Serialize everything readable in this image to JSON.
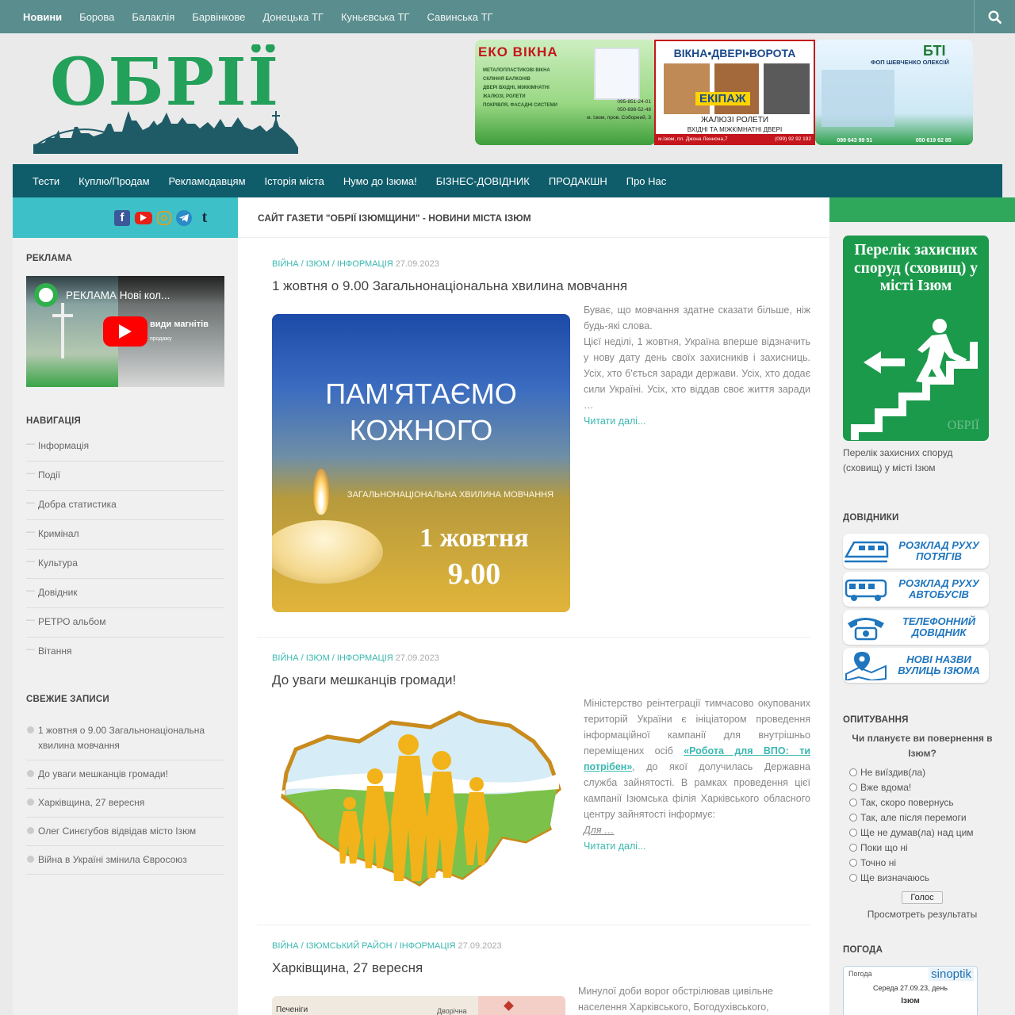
{
  "top_nav": {
    "items": [
      "Новини",
      "Борова",
      "Балаклія",
      "Барвінкове",
      "Донецька ТГ",
      "Куньєвська ТГ",
      "Савинська ТГ"
    ],
    "search_icon": "search-icon"
  },
  "header": {
    "logo_text": "ОБРІЇ",
    "banners": {
      "eko": {
        "title": "ЕКО ВІКНА",
        "line1": "МЕТАЛОПЛАСТИКОВІ ВІКНА",
        "line2": "СКЛІННЯ БАЛКОНІВ",
        "line3": "ДВЕРІ ВХІДНІ, МІЖКІМНАТНІ",
        "line4": "ЖАЛЮЗІ, РОЛЕТИ",
        "line5": "ПОКРІВЛЯ, ФАСАДНІ СИСТЕМИ",
        "phone1": "095-851-24-01",
        "phone2": "050-698-52-48",
        "address": "м. Ізюм, пров. Соборний, 3"
      },
      "ekipazh": {
        "title": "ВІКНА•ДВЕРІ•ВОРОТА",
        "brand": "ЕКІПАЖ",
        "sub": "ЖАЛЮЗІ РОЛЕТИ",
        "sub2": "ВХІДНІ ТА МІЖКІМНАТНІ ДВЕРІ",
        "address": "м.Ізюм, пл. Джона Леннона,7",
        "phone": "(099) 92 92 192"
      },
      "bti": {
        "title": "БТІ",
        "name": "ФОП ШЕВЧЕНКО ОЛЕКСІЙ",
        "phone1": "099 643 99 51",
        "phone2": "050 619 62 85"
      }
    }
  },
  "main_nav": {
    "items": [
      "Тести",
      "Куплю/Продам",
      "Рекламодавцям",
      "Історія міста",
      "Нумо до Ізюма!",
      "БІЗНЕС-ДОВІДНИК",
      "ПРОДАКШН",
      "Про Нас"
    ]
  },
  "left": {
    "ad_title": "РЕКЛАМА",
    "video_title": "РЕКЛАМА Нові кол...",
    "video_caption": "види магнітів",
    "video_caption2": "продажу",
    "nav_title": "НАВИГАЦІЯ",
    "nav_items": [
      "Інформація",
      "Події",
      "Добра статистика",
      "Кримінал",
      "Культура",
      "Довідник",
      "РЕТРО альбом",
      "Вітання"
    ],
    "recent_title": "СВЕЖИЕ ЗАПИСИ",
    "recent_items": [
      "1 жовтня о 9.00 Загальнонаціональна хвилина мовчання",
      "До уваги мешканців громади!",
      "Харківщина, 27 вересня",
      "Олег Синєгубов відвідав місто Ізюм",
      "Війна в Україні змінила Євросоюз"
    ]
  },
  "center": {
    "page_title": "САЙТ ГАЗЕТИ \"ОБРІЇ ІЗЮМЩИНИ\" - НОВИНИ МІСТА ІЗЮМ",
    "posts": [
      {
        "cats": [
          "ВІЙНА",
          "ІЗЮМ",
          "ІНФОРМАЦІЯ"
        ],
        "date": "27.09.2023",
        "title": "1 жовтня о 9.00 Загальнонаціональна хвилина мовчання",
        "excerpt": "Буває, що мовчання здатне сказати більше, ніж будь-які слова.\nЦієї неділі, 1 жовтня, Україна вперше відзначить у нову дату день своїх захисників і захисниць. Усіх, хто б'ється заради держави. Усіх, хто додає сили Україні. Усіх, хто віддав своє життя заради …",
        "more": "Читати далі...",
        "image_text": {
          "l1": "ПАМ'ЯТАЄМО",
          "l2": "КОЖНОГО",
          "l3": "ЗАГАЛЬНОНАЦІОНАЛЬНА ХВИЛИНА МОВЧАННЯ",
          "l4": "1 жовтня",
          "l5": "9.00"
        }
      },
      {
        "cats": [
          "ВІЙНА",
          "ІЗЮМ",
          "ІНФОРМАЦІЯ"
        ],
        "date": "27.09.2023",
        "title": "До уваги мешканців громади!",
        "excerpt_a": "Міністерство реінтеграції тимчасово окупованих територій України є ініціатором проведення інформаційної кампанії для внутрішньо переміщених осіб ",
        "excerpt_link": "«Робота для ВПО: ти потрібен»",
        "excerpt_b": ", до якої долучилась Державна служба зайнятості. В рамках проведення цієї кампанії Ізюмська філія Харківського обласного центру зайнятості інформує:",
        "excerpt_c": "Для …",
        "more": "Читати далі..."
      },
      {
        "cats": [
          "ВІЙНА",
          "ІЗЮМСЬКИЙ РАЙОН",
          "ІНФОРМАЦІЯ"
        ],
        "date": "27.09.2023",
        "title": "Харківщина, 27 вересня",
        "excerpt": "Минулої доби ворог обстрілював цивільне населення Харківського, Богодухівського,",
        "map_label1": "Печеніги",
        "map_label2": "Дворічна"
      }
    ]
  },
  "right": {
    "shelter_sign": "Перелік захисних споруд (сховищ) у місті Ізюм",
    "shelter_watermark": "ОБРІЇ",
    "shelter_caption": "Перелік захисних споруд (сховищ) у місті Ізюм",
    "dir_title": "ДОВІДНИКИ",
    "dirs": [
      {
        "l1": "РОЗКЛАД РУХУ",
        "l2": "ПОТЯГІВ",
        "icon": "train-icon"
      },
      {
        "l1": "РОЗКЛАД РУХУ",
        "l2": "АВТОБУСІВ",
        "icon": "bus-icon"
      },
      {
        "l1": "ТЕЛЕФОННИЙ",
        "l2": "ДОВІДНИК",
        "icon": "phone-icon"
      },
      {
        "l1": "НОВІ НАЗВИ",
        "l2": "ВУЛИЦЬ ІЗЮМА",
        "icon": "map-pin-icon"
      }
    ],
    "poll_title": "ОПИТУВАННЯ",
    "poll_question": "Чи плануєте ви повернення в Ізюм?",
    "poll_options": [
      "Не виїздив(ла)",
      "Вже вдома!",
      "Так, скоро повернусь",
      "Так, але після перемоги",
      "Ще не думав(ла) над цим",
      "Поки що ні",
      "Точно ні",
      "Ще визначаюсь"
    ],
    "vote_btn": "Голос",
    "results_link": "Просмотреть результаты",
    "weather_title": "ПОГОДА",
    "weather_label": "Погода",
    "weather_brand": "sinoptik",
    "weather_date": "Середа 27.09.23, день",
    "weather_city": "Ізюм"
  }
}
